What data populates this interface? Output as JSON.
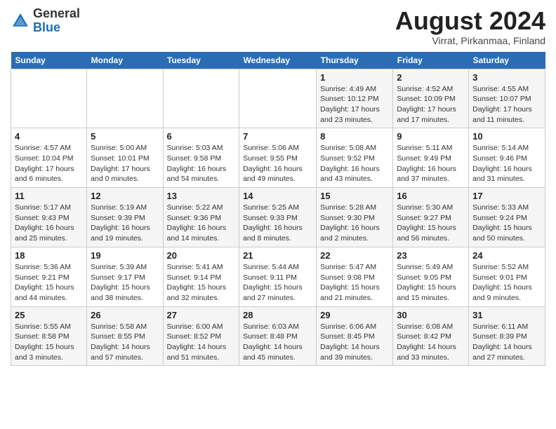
{
  "header": {
    "logo_general": "General",
    "logo_blue": "Blue",
    "main_title": "August 2024",
    "subtitle": "Virrat, Pirkanmaa, Finland"
  },
  "days_of_week": [
    "Sunday",
    "Monday",
    "Tuesday",
    "Wednesday",
    "Thursday",
    "Friday",
    "Saturday"
  ],
  "weeks": [
    [
      {
        "day": "",
        "content": ""
      },
      {
        "day": "",
        "content": ""
      },
      {
        "day": "",
        "content": ""
      },
      {
        "day": "",
        "content": ""
      },
      {
        "day": "1",
        "content": "Sunrise: 4:49 AM\nSunset: 10:12 PM\nDaylight: 17 hours\nand 23 minutes."
      },
      {
        "day": "2",
        "content": "Sunrise: 4:52 AM\nSunset: 10:09 PM\nDaylight: 17 hours\nand 17 minutes."
      },
      {
        "day": "3",
        "content": "Sunrise: 4:55 AM\nSunset: 10:07 PM\nDaylight: 17 hours\nand 11 minutes."
      }
    ],
    [
      {
        "day": "4",
        "content": "Sunrise: 4:57 AM\nSunset: 10:04 PM\nDaylight: 17 hours\nand 6 minutes."
      },
      {
        "day": "5",
        "content": "Sunrise: 5:00 AM\nSunset: 10:01 PM\nDaylight: 17 hours\nand 0 minutes."
      },
      {
        "day": "6",
        "content": "Sunrise: 5:03 AM\nSunset: 9:58 PM\nDaylight: 16 hours\nand 54 minutes."
      },
      {
        "day": "7",
        "content": "Sunrise: 5:06 AM\nSunset: 9:55 PM\nDaylight: 16 hours\nand 49 minutes."
      },
      {
        "day": "8",
        "content": "Sunrise: 5:08 AM\nSunset: 9:52 PM\nDaylight: 16 hours\nand 43 minutes."
      },
      {
        "day": "9",
        "content": "Sunrise: 5:11 AM\nSunset: 9:49 PM\nDaylight: 16 hours\nand 37 minutes."
      },
      {
        "day": "10",
        "content": "Sunrise: 5:14 AM\nSunset: 9:46 PM\nDaylight: 16 hours\nand 31 minutes."
      }
    ],
    [
      {
        "day": "11",
        "content": "Sunrise: 5:17 AM\nSunset: 9:43 PM\nDaylight: 16 hours\nand 25 minutes."
      },
      {
        "day": "12",
        "content": "Sunrise: 5:19 AM\nSunset: 9:39 PM\nDaylight: 16 hours\nand 19 minutes."
      },
      {
        "day": "13",
        "content": "Sunrise: 5:22 AM\nSunset: 9:36 PM\nDaylight: 16 hours\nand 14 minutes."
      },
      {
        "day": "14",
        "content": "Sunrise: 5:25 AM\nSunset: 9:33 PM\nDaylight: 16 hours\nand 8 minutes."
      },
      {
        "day": "15",
        "content": "Sunrise: 5:28 AM\nSunset: 9:30 PM\nDaylight: 16 hours\nand 2 minutes."
      },
      {
        "day": "16",
        "content": "Sunrise: 5:30 AM\nSunset: 9:27 PM\nDaylight: 15 hours\nand 56 minutes."
      },
      {
        "day": "17",
        "content": "Sunrise: 5:33 AM\nSunset: 9:24 PM\nDaylight: 15 hours\nand 50 minutes."
      }
    ],
    [
      {
        "day": "18",
        "content": "Sunrise: 5:36 AM\nSunset: 9:21 PM\nDaylight: 15 hours\nand 44 minutes."
      },
      {
        "day": "19",
        "content": "Sunrise: 5:39 AM\nSunset: 9:17 PM\nDaylight: 15 hours\nand 38 minutes."
      },
      {
        "day": "20",
        "content": "Sunrise: 5:41 AM\nSunset: 9:14 PM\nDaylight: 15 hours\nand 32 minutes."
      },
      {
        "day": "21",
        "content": "Sunrise: 5:44 AM\nSunset: 9:11 PM\nDaylight: 15 hours\nand 27 minutes."
      },
      {
        "day": "22",
        "content": "Sunrise: 5:47 AM\nSunset: 9:08 PM\nDaylight: 15 hours\nand 21 minutes."
      },
      {
        "day": "23",
        "content": "Sunrise: 5:49 AM\nSunset: 9:05 PM\nDaylight: 15 hours\nand 15 minutes."
      },
      {
        "day": "24",
        "content": "Sunrise: 5:52 AM\nSunset: 9:01 PM\nDaylight: 15 hours\nand 9 minutes."
      }
    ],
    [
      {
        "day": "25",
        "content": "Sunrise: 5:55 AM\nSunset: 8:58 PM\nDaylight: 15 hours\nand 3 minutes."
      },
      {
        "day": "26",
        "content": "Sunrise: 5:58 AM\nSunset: 8:55 PM\nDaylight: 14 hours\nand 57 minutes."
      },
      {
        "day": "27",
        "content": "Sunrise: 6:00 AM\nSunset: 8:52 PM\nDaylight: 14 hours\nand 51 minutes."
      },
      {
        "day": "28",
        "content": "Sunrise: 6:03 AM\nSunset: 8:48 PM\nDaylight: 14 hours\nand 45 minutes."
      },
      {
        "day": "29",
        "content": "Sunrise: 6:06 AM\nSunset: 8:45 PM\nDaylight: 14 hours\nand 39 minutes."
      },
      {
        "day": "30",
        "content": "Sunrise: 6:08 AM\nSunset: 8:42 PM\nDaylight: 14 hours\nand 33 minutes."
      },
      {
        "day": "31",
        "content": "Sunrise: 6:11 AM\nSunset: 8:39 PM\nDaylight: 14 hours\nand 27 minutes."
      }
    ]
  ]
}
